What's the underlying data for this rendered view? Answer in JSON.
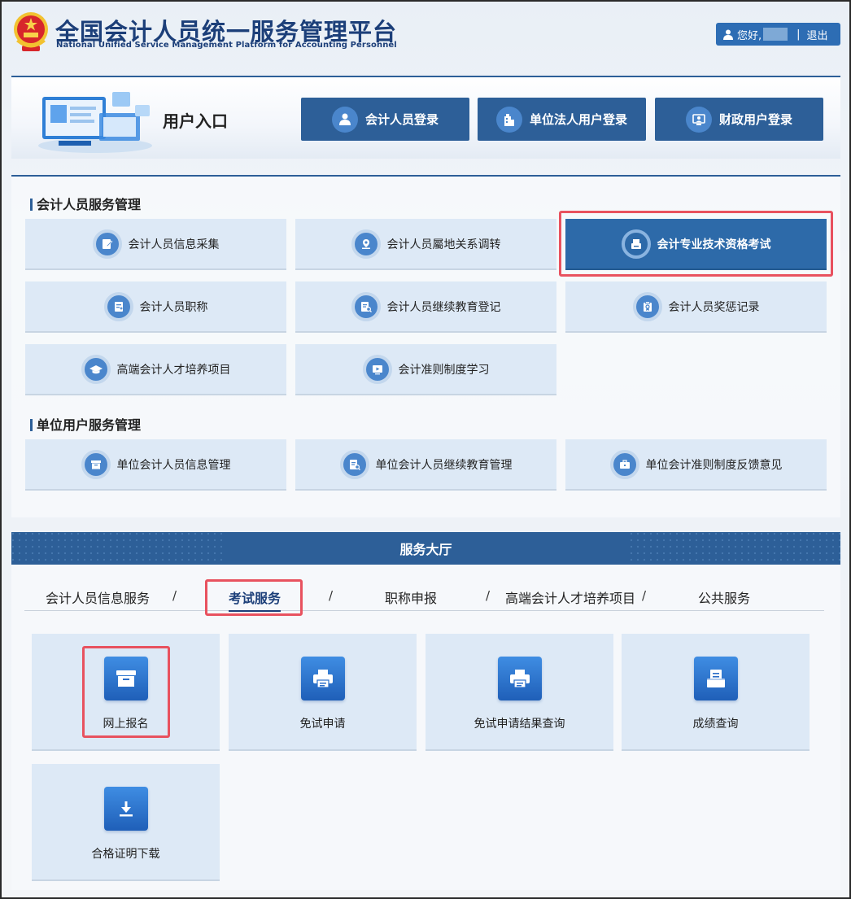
{
  "header": {
    "title_cn": "全国会计人员统一服务管理平台",
    "title_en": "National Unified Service Management Platform for Accounting Personnel",
    "greeting": "您好,",
    "separator": "|",
    "logout": "退出"
  },
  "entry": {
    "title": "用户入口",
    "buttons": [
      {
        "label": "会计人员登录",
        "icon": "user-icon"
      },
      {
        "label": "单位法人用户登录",
        "icon": "building-icon"
      },
      {
        "label": "财政用户登录",
        "icon": "monitor-user-icon"
      }
    ]
  },
  "services": {
    "personal_title": "会计人员服务管理",
    "personal_items": [
      {
        "label": "会计人员信息采集",
        "icon": "edit-doc-icon"
      },
      {
        "label": "会计人员屬地关系调转",
        "icon": "location-icon"
      },
      {
        "label": "会计专业技术资格考试",
        "icon": "exam-icon",
        "active": true
      },
      {
        "label": "会计人员职称",
        "icon": "title-doc-icon"
      },
      {
        "label": "会计人员继续教育登记",
        "icon": "search-doc-icon"
      },
      {
        "label": "会计人员奖惩记录",
        "icon": "clipboard-icon"
      },
      {
        "label": "高端会计人才培养项目",
        "icon": "graduation-cap-icon"
      },
      {
        "label": "会计准则制度学习",
        "icon": "play-icon"
      }
    ],
    "unit_title": "单位用户服务管理",
    "unit_items": [
      {
        "label": "单位会计人员信息管理",
        "icon": "archive-icon"
      },
      {
        "label": "单位会计人员继续教育管理",
        "icon": "search-doc-icon"
      },
      {
        "label": "单位会计准则制度反馈意见",
        "icon": "briefcase-icon"
      }
    ]
  },
  "hall": {
    "title": "服务大厅",
    "tabs": [
      "会计人员信息服务",
      "考试服务",
      "职称申报",
      "高端会计人才培养项目",
      "公共服务"
    ],
    "separator": "/",
    "active_tab": "考试服务",
    "tiles": [
      {
        "label": "网上报名",
        "icon": "archive-box-icon"
      },
      {
        "label": "免试申请",
        "icon": "printer-icon"
      },
      {
        "label": "免试申请结果查询",
        "icon": "printer-icon"
      },
      {
        "label": "成绩查询",
        "icon": "stack-doc-icon"
      },
      {
        "label": "合格证明下载",
        "icon": "download-icon"
      }
    ]
  },
  "colors": {
    "primary": "#2d5f98",
    "accent": "#2d6db4",
    "card_bg": "#dde9f6",
    "highlight": "#e8525f",
    "title": "#1c3f79"
  }
}
